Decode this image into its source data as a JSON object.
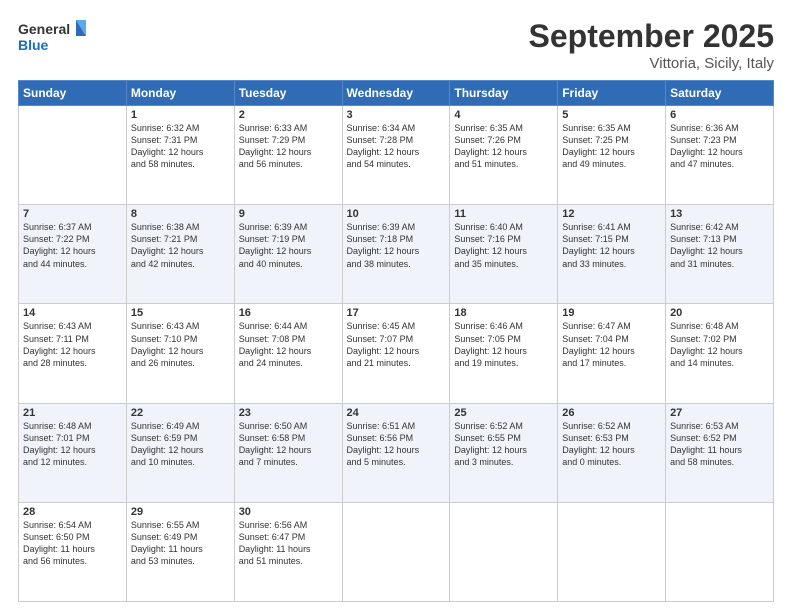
{
  "logo": {
    "line1": "General",
    "line2": "Blue"
  },
  "title": "September 2025",
  "location": "Vittoria, Sicily, Italy",
  "weekdays": [
    "Sunday",
    "Monday",
    "Tuesday",
    "Wednesday",
    "Thursday",
    "Friday",
    "Saturday"
  ],
  "weeks": [
    [
      {
        "day": "",
        "info": ""
      },
      {
        "day": "1",
        "info": "Sunrise: 6:32 AM\nSunset: 7:31 PM\nDaylight: 12 hours\nand 58 minutes."
      },
      {
        "day": "2",
        "info": "Sunrise: 6:33 AM\nSunset: 7:29 PM\nDaylight: 12 hours\nand 56 minutes."
      },
      {
        "day": "3",
        "info": "Sunrise: 6:34 AM\nSunset: 7:28 PM\nDaylight: 12 hours\nand 54 minutes."
      },
      {
        "day": "4",
        "info": "Sunrise: 6:35 AM\nSunset: 7:26 PM\nDaylight: 12 hours\nand 51 minutes."
      },
      {
        "day": "5",
        "info": "Sunrise: 6:35 AM\nSunset: 7:25 PM\nDaylight: 12 hours\nand 49 minutes."
      },
      {
        "day": "6",
        "info": "Sunrise: 6:36 AM\nSunset: 7:23 PM\nDaylight: 12 hours\nand 47 minutes."
      }
    ],
    [
      {
        "day": "7",
        "info": "Sunrise: 6:37 AM\nSunset: 7:22 PM\nDaylight: 12 hours\nand 44 minutes."
      },
      {
        "day": "8",
        "info": "Sunrise: 6:38 AM\nSunset: 7:21 PM\nDaylight: 12 hours\nand 42 minutes."
      },
      {
        "day": "9",
        "info": "Sunrise: 6:39 AM\nSunset: 7:19 PM\nDaylight: 12 hours\nand 40 minutes."
      },
      {
        "day": "10",
        "info": "Sunrise: 6:39 AM\nSunset: 7:18 PM\nDaylight: 12 hours\nand 38 minutes."
      },
      {
        "day": "11",
        "info": "Sunrise: 6:40 AM\nSunset: 7:16 PM\nDaylight: 12 hours\nand 35 minutes."
      },
      {
        "day": "12",
        "info": "Sunrise: 6:41 AM\nSunset: 7:15 PM\nDaylight: 12 hours\nand 33 minutes."
      },
      {
        "day": "13",
        "info": "Sunrise: 6:42 AM\nSunset: 7:13 PM\nDaylight: 12 hours\nand 31 minutes."
      }
    ],
    [
      {
        "day": "14",
        "info": "Sunrise: 6:43 AM\nSunset: 7:11 PM\nDaylight: 12 hours\nand 28 minutes."
      },
      {
        "day": "15",
        "info": "Sunrise: 6:43 AM\nSunset: 7:10 PM\nDaylight: 12 hours\nand 26 minutes."
      },
      {
        "day": "16",
        "info": "Sunrise: 6:44 AM\nSunset: 7:08 PM\nDaylight: 12 hours\nand 24 minutes."
      },
      {
        "day": "17",
        "info": "Sunrise: 6:45 AM\nSunset: 7:07 PM\nDaylight: 12 hours\nand 21 minutes."
      },
      {
        "day": "18",
        "info": "Sunrise: 6:46 AM\nSunset: 7:05 PM\nDaylight: 12 hours\nand 19 minutes."
      },
      {
        "day": "19",
        "info": "Sunrise: 6:47 AM\nSunset: 7:04 PM\nDaylight: 12 hours\nand 17 minutes."
      },
      {
        "day": "20",
        "info": "Sunrise: 6:48 AM\nSunset: 7:02 PM\nDaylight: 12 hours\nand 14 minutes."
      }
    ],
    [
      {
        "day": "21",
        "info": "Sunrise: 6:48 AM\nSunset: 7:01 PM\nDaylight: 12 hours\nand 12 minutes."
      },
      {
        "day": "22",
        "info": "Sunrise: 6:49 AM\nSunset: 6:59 PM\nDaylight: 12 hours\nand 10 minutes."
      },
      {
        "day": "23",
        "info": "Sunrise: 6:50 AM\nSunset: 6:58 PM\nDaylight: 12 hours\nand 7 minutes."
      },
      {
        "day": "24",
        "info": "Sunrise: 6:51 AM\nSunset: 6:56 PM\nDaylight: 12 hours\nand 5 minutes."
      },
      {
        "day": "25",
        "info": "Sunrise: 6:52 AM\nSunset: 6:55 PM\nDaylight: 12 hours\nand 3 minutes."
      },
      {
        "day": "26",
        "info": "Sunrise: 6:52 AM\nSunset: 6:53 PM\nDaylight: 12 hours\nand 0 minutes."
      },
      {
        "day": "27",
        "info": "Sunrise: 6:53 AM\nSunset: 6:52 PM\nDaylight: 11 hours\nand 58 minutes."
      }
    ],
    [
      {
        "day": "28",
        "info": "Sunrise: 6:54 AM\nSunset: 6:50 PM\nDaylight: 11 hours\nand 56 minutes."
      },
      {
        "day": "29",
        "info": "Sunrise: 6:55 AM\nSunset: 6:49 PM\nDaylight: 11 hours\nand 53 minutes."
      },
      {
        "day": "30",
        "info": "Sunrise: 6:56 AM\nSunset: 6:47 PM\nDaylight: 11 hours\nand 51 minutes."
      },
      {
        "day": "",
        "info": ""
      },
      {
        "day": "",
        "info": ""
      },
      {
        "day": "",
        "info": ""
      },
      {
        "day": "",
        "info": ""
      }
    ]
  ]
}
